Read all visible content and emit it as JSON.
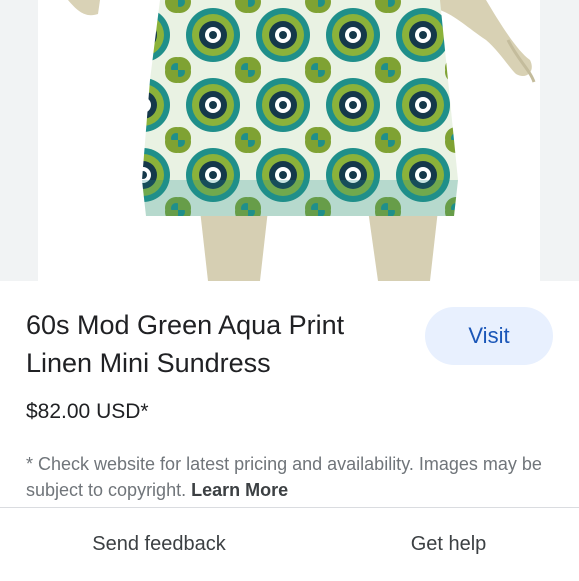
{
  "product": {
    "title_line1": "60s Mod Green Aqua Print",
    "title_line2": "Linen Mini Sundress",
    "price": "$82.00 USD*",
    "visit_label": "Visit"
  },
  "disclaimer": {
    "text": "* Check website for latest pricing and availability. Images may be subject to copyright.",
    "learn_more": "Learn More"
  },
  "footer": {
    "send_feedback": "Send feedback",
    "get_help": "Get help"
  },
  "colors": {
    "button_bg": "#e8f0fe",
    "button_text": "#1a56b8",
    "print_green": "#7fa233",
    "print_teal": "#1f8f8a"
  },
  "image": {
    "subject": "mannequin wearing green and aqua floral print mini dress"
  }
}
